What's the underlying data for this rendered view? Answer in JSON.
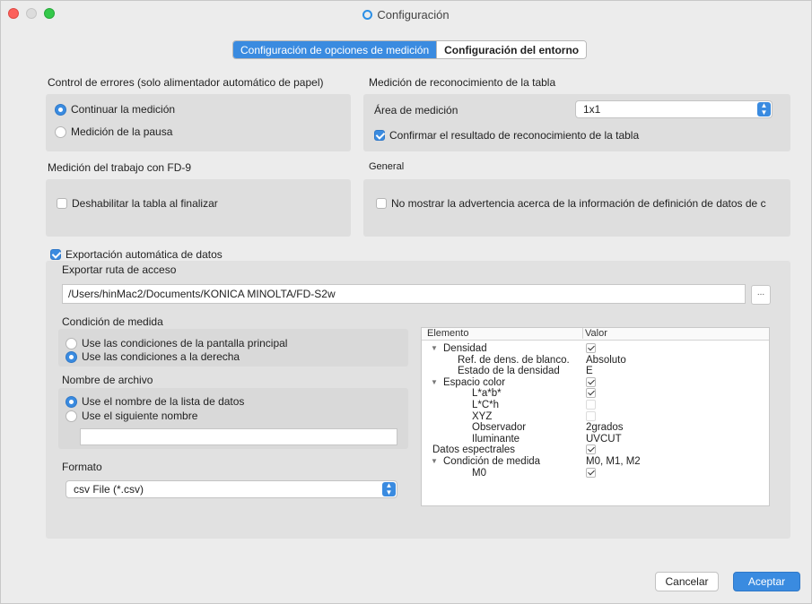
{
  "window": {
    "title": "Configuración"
  },
  "tabs": [
    {
      "label": "Configuración de opciones de medición",
      "active": true
    },
    {
      "label": "Configuración del entorno",
      "active": false
    }
  ],
  "error_control": {
    "label": "Control de errores (solo alimentador automático de papel)",
    "options": [
      {
        "label": "Continuar la medición",
        "selected": true
      },
      {
        "label": "Medición de la pausa",
        "selected": false
      }
    ]
  },
  "table_recognition": {
    "label": "Medición de reconocimiento de la tabla",
    "area_label": "Área de medición",
    "area_value": "1x1",
    "confirm_label": "Confirmar el resultado de reconocimiento de la tabla",
    "confirm_checked": true
  },
  "fd9": {
    "label": "Medición del trabajo con FD-9",
    "disable_label": "Deshabilitar la tabla al finalizar",
    "disable_checked": false
  },
  "general": {
    "label": "General",
    "no_warning_label": "No mostrar la advertencia acerca de la información de definición de datos de c",
    "no_warning_checked": false
  },
  "export": {
    "auto_label": "Exportación automática de datos",
    "auto_checked": true,
    "path_label": "Exportar ruta de acceso",
    "path_value": "/Users/hinMac2/Documents/KONICA MINOLTA/FD-S2w",
    "browse_label": "..."
  },
  "measure_condition": {
    "label": "Condición de medida",
    "options": [
      {
        "label": "Use las condiciones de la pantalla principal",
        "selected": false
      },
      {
        "label": "Use las condiciones a la derecha",
        "selected": true
      }
    ]
  },
  "file_name": {
    "label": "Nombre de archivo",
    "options": [
      {
        "label": "Use el nombre de la lista de datos",
        "selected": true
      },
      {
        "label": "Use el siguiente nombre",
        "selected": false
      }
    ],
    "custom_value": ""
  },
  "format": {
    "label": "Formato",
    "value": "csv File (*.csv)"
  },
  "tree": {
    "col_element": "Elemento",
    "col_value": "Valor",
    "rows": [
      {
        "name": "Densidad",
        "value": "",
        "check": "on",
        "indent": 0,
        "expand": true
      },
      {
        "name": "Ref. de dens. de blanco.",
        "value": "Absoluto",
        "check": "",
        "indent": 1,
        "expand": false
      },
      {
        "name": "Estado de la densidad",
        "value": "E",
        "check": "",
        "indent": 1,
        "expand": false
      },
      {
        "name": "Espacio color",
        "value": "",
        "check": "on",
        "indent": 0,
        "expand": true
      },
      {
        "name": "L*a*b*",
        "value": "",
        "check": "on",
        "indent": 2,
        "expand": false
      },
      {
        "name": "L*C*h",
        "value": "",
        "check": "off",
        "indent": 2,
        "expand": false
      },
      {
        "name": "XYZ",
        "value": "",
        "check": "off",
        "indent": 2,
        "expand": false
      },
      {
        "name": "Observador",
        "value": "2grados",
        "check": "",
        "indent": 2,
        "expand": false
      },
      {
        "name": "Iluminante",
        "value": "UVCUT",
        "check": "",
        "indent": 2,
        "expand": false
      },
      {
        "name": "Datos espectrales",
        "value": "",
        "check": "on",
        "indent": -1,
        "expand": false
      },
      {
        "name": "Condición de medida",
        "value": "M0, M1, M2",
        "check": "",
        "indent": 0,
        "expand": true
      },
      {
        "name": "M0",
        "value": "",
        "check": "on",
        "indent": 2,
        "expand": false
      }
    ]
  },
  "buttons": {
    "cancel": "Cancelar",
    "ok": "Aceptar"
  },
  "colors": {
    "accent": "#3a8be0",
    "window_bg": "#ececec",
    "panel_bg": "#e3e3e3"
  }
}
